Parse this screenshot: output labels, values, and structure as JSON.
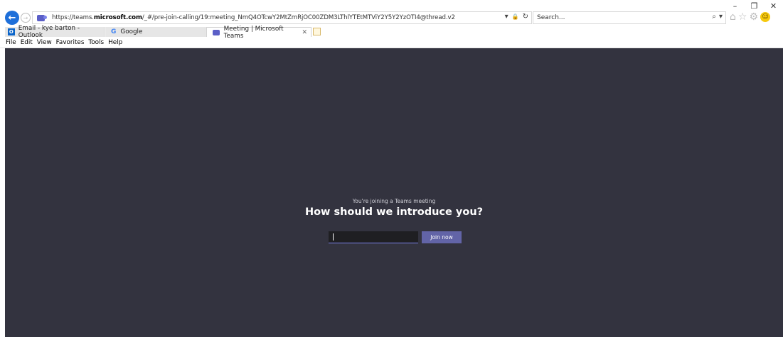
{
  "window": {
    "minimize": "–",
    "restore": "❐",
    "close": "✕"
  },
  "nav": {
    "back_glyph": "←",
    "forward_glyph": "→"
  },
  "address": {
    "url_prefix": "https://teams.",
    "url_domain": "microsoft.com",
    "url_suffix": "/_#/pre-join-calling/19:meeting_NmQ4OTcwY2MtZmRjOC00ZDM3LThlYTEtMTViY2Y5Y2YzOTI4@thread.v2",
    "dropdown_glyph": "▾",
    "lock_glyph": "🔒",
    "refresh_glyph": "↻"
  },
  "search": {
    "placeholder": "Search...",
    "search_glyph": "⌕",
    "dropdown_glyph": "▾"
  },
  "toolbar_icons": {
    "home": "⌂",
    "favorites": "☆",
    "settings": "⚙",
    "smiley": "☺"
  },
  "tabs": [
    {
      "label": "Email - kye barton - Outlook",
      "icon": "outlook-icon",
      "icon_text": "O"
    },
    {
      "label": "Google",
      "icon": "google-icon",
      "icon_text": "G"
    },
    {
      "label": "Meeting | Microsoft Teams",
      "icon": "teams-icon",
      "close": "✕"
    }
  ],
  "menu": [
    "File",
    "Edit",
    "View",
    "Favorites",
    "Tools",
    "Help"
  ],
  "meeting": {
    "joining_text": "You're joining a Teams meeting",
    "heading": "How should we introduce you?",
    "name_value": "",
    "join_label": "Join now"
  },
  "colors": {
    "content_bg": "#33333f",
    "join_button": "#6264a7",
    "back_button": "#1e6fd9"
  }
}
